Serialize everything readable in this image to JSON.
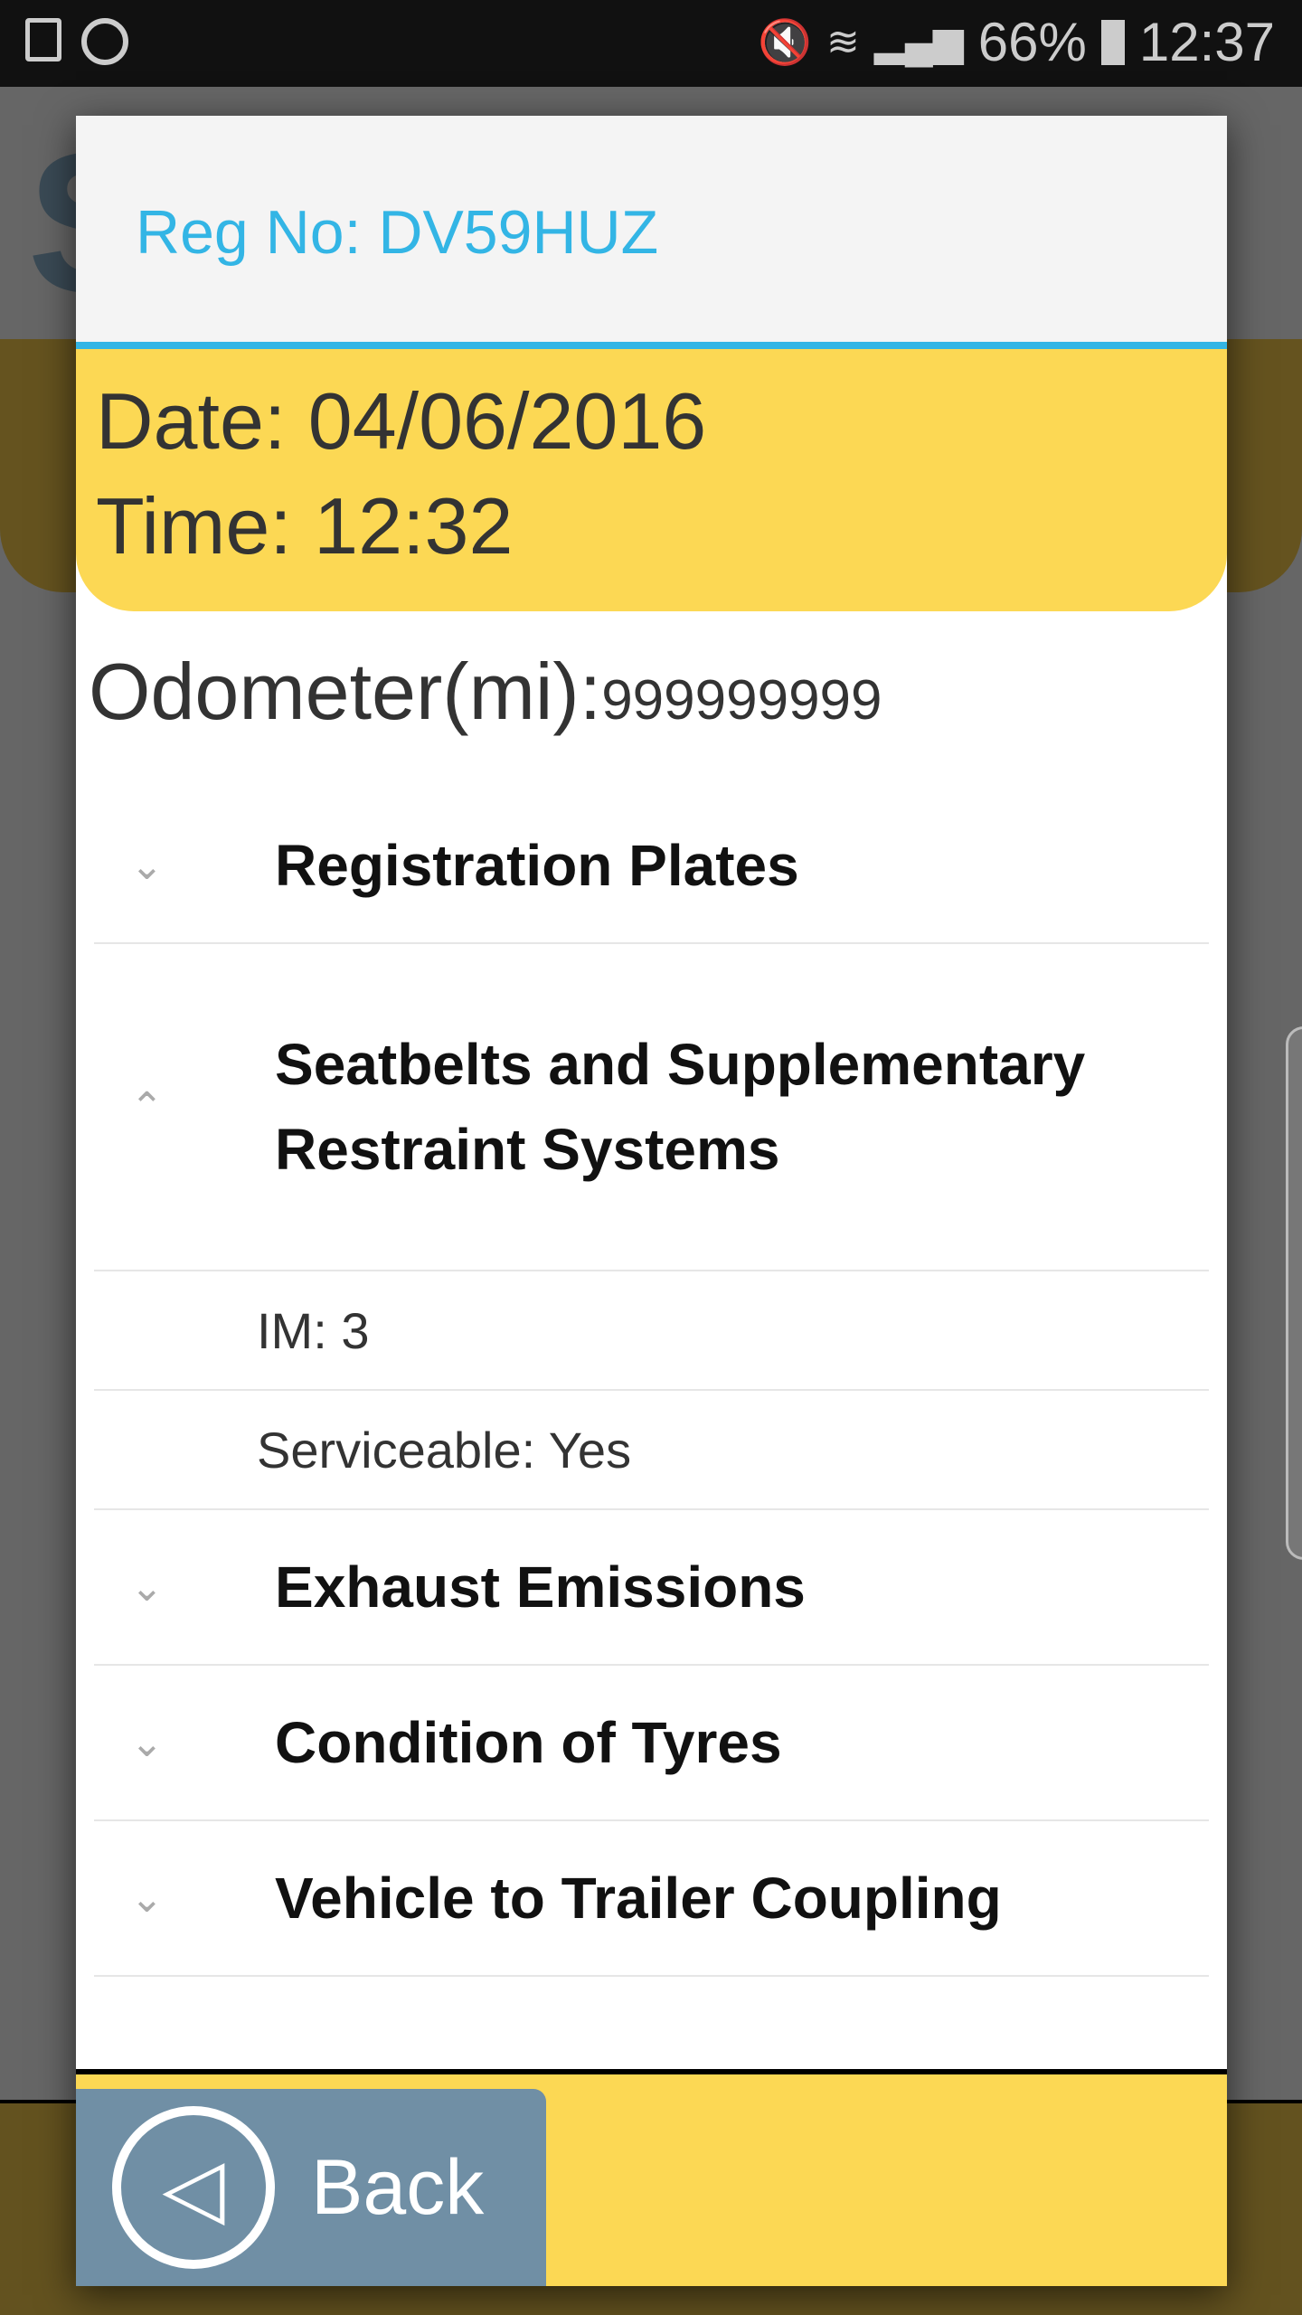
{
  "status_bar": {
    "battery": "66%",
    "time": "12:37"
  },
  "dialog": {
    "title": "Reg No: DV59HUZ",
    "date": "Date: 04/06/2016",
    "time": "Time: 12:32",
    "odometer_label": "Odometer(mi):",
    "odometer_value": "999999999",
    "sections": [
      {
        "label": "Registration Plates",
        "expanded": false
      },
      {
        "label": "Seatbelts and Supplementary Restraint Systems",
        "expanded": true,
        "details": [
          "IM: 3",
          "Serviceable: Yes"
        ]
      },
      {
        "label": "Exhaust Emissions",
        "expanded": false
      },
      {
        "label": "Condition of Tyres",
        "expanded": false
      },
      {
        "label": "Vehicle to Trailer Coupling",
        "expanded": false
      }
    ],
    "back_label": "Back"
  },
  "colors": {
    "accent": "#33b5e5",
    "yellow": "#fcd854",
    "back_button": "#708fa5"
  }
}
